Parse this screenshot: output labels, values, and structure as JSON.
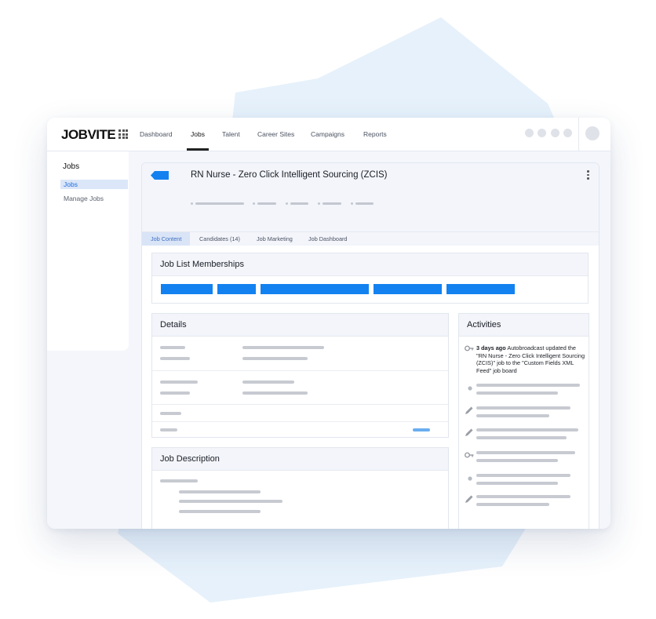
{
  "app": {
    "logo": "JOBVITE"
  },
  "nav": {
    "tabs": [
      {
        "label": "Dashboard"
      },
      {
        "label": "Jobs",
        "active": true
      },
      {
        "label": "Talent"
      },
      {
        "label": "Career Sites"
      },
      {
        "label": "Campaigns"
      },
      {
        "label": "Reports"
      }
    ]
  },
  "sidebar": {
    "title": "Jobs",
    "items": [
      {
        "label": "Jobs",
        "active": true
      },
      {
        "label": "Manage Jobs"
      }
    ]
  },
  "job": {
    "title": "RN Nurse - Zero Click Intelligent Sourcing (ZCIS)"
  },
  "subtabs": [
    {
      "label": "Job Content",
      "active": true
    },
    {
      "label": "Candidates (14)"
    },
    {
      "label": "Job Marketing"
    },
    {
      "label": "Job Dashboard"
    }
  ],
  "sections": {
    "memberships_title": "Job List Memberships",
    "details_title": "Details",
    "description_title": "Job Description",
    "activities_title": "Activities"
  },
  "activities": {
    "first": {
      "time": "3 days ago",
      "text": "Autobroadcast updated the \"RN Nurse - Zero Click Intelligent Sourcing (ZCIS)\" job to the \"Custom Fields XML Feed\" job board",
      "icon": "key-icon"
    },
    "placeholder_icons": [
      "dot-icon",
      "pencil-icon",
      "pencil-icon",
      "key-icon",
      "dot-icon",
      "pencil-icon"
    ]
  },
  "colors": {
    "accent": "#1382f0",
    "link": "#6aaef0",
    "active_tab_bg": "#d9e4f7",
    "background_shape": "#e6f1fb"
  }
}
